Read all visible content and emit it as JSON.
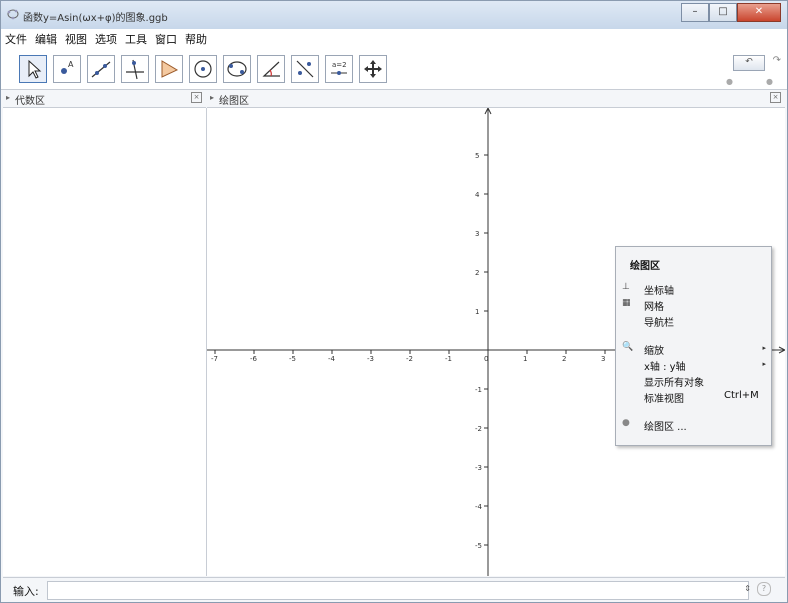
{
  "window": {
    "title": "函数y=Asin(ωx+φ)的图象.ggb",
    "minimize_label": "–",
    "maximize_label": "□",
    "close_label": "✕"
  },
  "menu": [
    "文件",
    "编辑",
    "视图",
    "选项",
    "工具",
    "窗口",
    "帮助"
  ],
  "toolbar": {
    "tools": [
      "move-tool-icon",
      "point-tool-icon",
      "line-tool-icon",
      "perpendicular-tool-icon",
      "polygon-tool-icon",
      "circle-tool-icon",
      "conic-tool-icon",
      "angle-tool-icon",
      "reflect-tool-icon",
      "slider-tool-icon",
      "move-view-tool-icon"
    ],
    "undo_label": "↶",
    "redo_label": "↷"
  },
  "algebra_panel": {
    "title": "代数区"
  },
  "graphics_panel": {
    "title": "绘图区",
    "x_ticks": [
      "-7",
      "-6",
      "-5",
      "-4",
      "-3",
      "-2",
      "-1",
      "0",
      "1",
      "2",
      "3"
    ],
    "y_ticks": [
      "5",
      "4",
      "3",
      "2",
      "1",
      "-1",
      "-2",
      "-3",
      "-4",
      "-5"
    ]
  },
  "context_menu": {
    "title": "绘图区",
    "items": [
      "坐标轴",
      "网格",
      "导航栏",
      "缩放",
      "x轴 : y轴",
      "显示所有对象",
      "标准视图",
      "绘图区 ..."
    ],
    "shortcut_standard_view": "Ctrl+M"
  },
  "input_bar": {
    "label": "输入:",
    "value": "",
    "help_label": "?"
  }
}
